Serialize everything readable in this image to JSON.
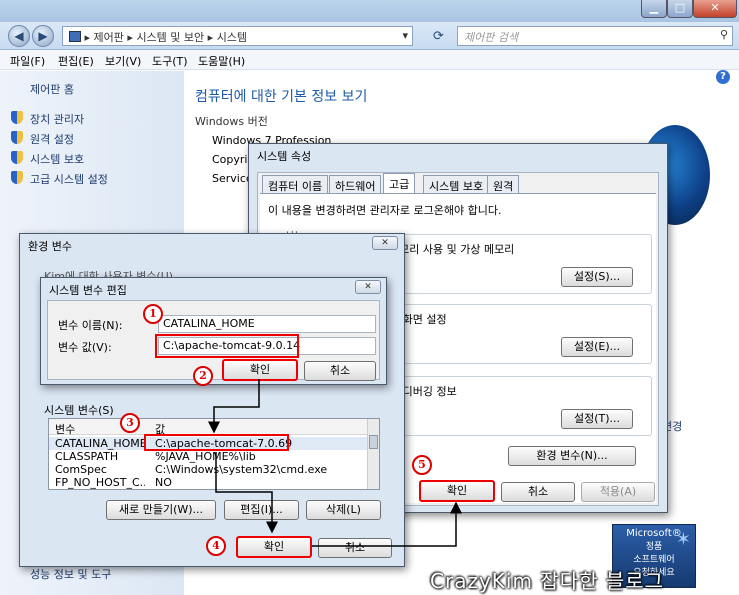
{
  "explorer": {
    "breadcrumb": [
      "제어판",
      "시스템 및 보안",
      "시스템"
    ],
    "search_placeholder": "제어판 검색",
    "menu": [
      "파일(F)",
      "편집(E)",
      "보기(V)",
      "도구(T)",
      "도움말(H)"
    ],
    "left_home": "제어판 홈",
    "left_links": [
      "장치 관리자",
      "원격 설정",
      "시스템 보호",
      "고급 시스템 설정"
    ],
    "left_bottom": "성능 정보 및 도구",
    "heading": "컴퓨터에 대한 기본 정보 보기",
    "section_windows": "Windows 버전",
    "win_edition": "Windows 7 Professional K",
    "win_copyright": "Copyright",
    "win_service": "Service",
    "change_link": "변경",
    "genuine_title": "Microsoft®",
    "genuine_sub1": "정품",
    "genuine_sub2": "소프트웨어",
    "genuine_sub3": "요청하세요"
  },
  "sysprops": {
    "title": "시스템 속성",
    "tabs": [
      "컴퓨터 이름",
      "하드웨어",
      "고급",
      "시스템 보호",
      "원격"
    ],
    "admin_note": "이 내용을 변경하려면 관리자로 로그온해야 합니다.",
    "perf_label": "성능",
    "perf_desc": "메모리 사용 및 가상 메모리",
    "perf_btn": "설정(S)...",
    "profile_desc": "탕 화면 설정",
    "profile_btn": "설정(E)...",
    "startup_desc": "및 디버깅 정보",
    "startup_btn": "설정(T)...",
    "env_btn": "환경 변수(N)...",
    "ok": "확인",
    "cancel": "취소",
    "apply": "적용(A)"
  },
  "envvars": {
    "title": "환경 변수",
    "user_vars_label": "Kim에 대한 사용자 변수(U)",
    "system_vars_label": "시스템 변수(S)",
    "col_var": "변수",
    "col_val": "값",
    "rows": [
      {
        "name": "CATALINA_HOME",
        "value": "C:\\apache-tomcat-7.0.69"
      },
      {
        "name": "CLASSPATH",
        "value": "%JAVA_HOME%\\lib"
      },
      {
        "name": "ComSpec",
        "value": "C:\\Windows\\system32\\cmd.exe"
      },
      {
        "name": "FP_NO_HOST_C...",
        "value": "NO"
      }
    ],
    "new_btn": "새로 만들기(W)...",
    "edit_btn": "편집(I)...",
    "delete_btn": "삭제(L)",
    "ok": "확인",
    "cancel": "취소"
  },
  "editvar": {
    "title": "시스템 변수 편집",
    "name_label": "변수 이름(N):",
    "value_label": "변수 값(V):",
    "name_value": "CATALINA_HOME",
    "value_value": "C:\\apache-tomcat-9.0.14",
    "ok": "확인",
    "cancel": "취소"
  },
  "markers": [
    "1",
    "2",
    "3",
    "4",
    "5"
  ],
  "watermark": "CrazyKim 잡다한 블로그",
  "colors": {
    "highlight": "#e00000",
    "link": "#1e3c6e",
    "heading": "#1e5aa8"
  }
}
